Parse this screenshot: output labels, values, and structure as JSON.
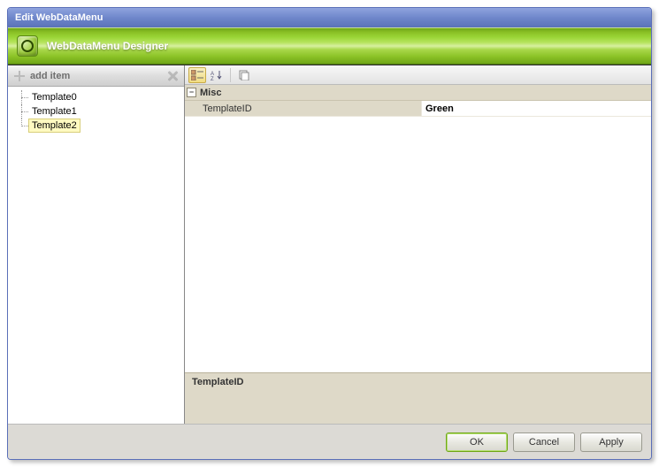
{
  "titlebar": "Edit WebDataMenu",
  "header": {
    "title": "WebDataMenu Designer"
  },
  "sidebar": {
    "add_label": "add item",
    "items": [
      {
        "label": "Template0",
        "selected": false
      },
      {
        "label": "Template1",
        "selected": false
      },
      {
        "label": "Template2",
        "selected": true
      }
    ]
  },
  "props": {
    "category": "Misc",
    "rows": [
      {
        "name": "TemplateID",
        "value": "Green",
        "selected": true
      }
    ],
    "description_title": "TemplateID",
    "description_body": ""
  },
  "footer": {
    "ok": "OK",
    "cancel": "Cancel",
    "apply": "Apply"
  }
}
